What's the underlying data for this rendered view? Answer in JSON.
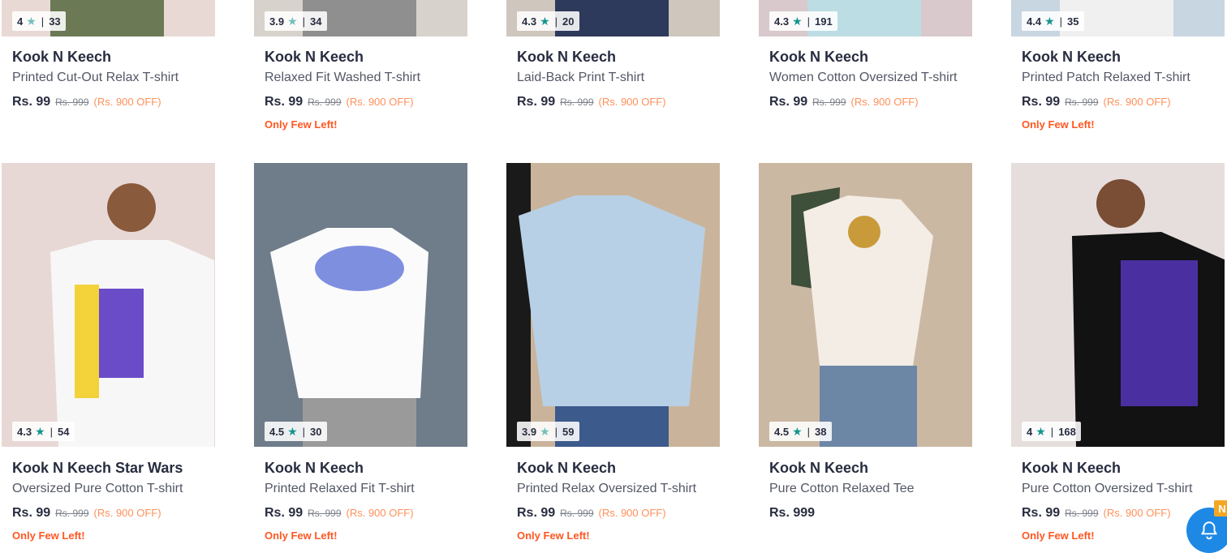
{
  "colors": {
    "star_teal": "#14958f",
    "star_light": "#72bfbc",
    "offer": "#ff905a",
    "few_left": "#ff5722",
    "bell": "#1e88e5"
  },
  "products": [
    {
      "rating": "4",
      "star": "light",
      "reviews": "33",
      "brand": "Kook N Keech",
      "name": "Printed Cut-Out Relax T-shirt",
      "price": "Rs. 99",
      "mrp": "Rs. 999",
      "off": "(Rs. 900 OFF)",
      "few": ""
    },
    {
      "rating": "3.9",
      "star": "light",
      "reviews": "34",
      "brand": "Kook N Keech",
      "name": "Relaxed Fit Washed T-shirt",
      "price": "Rs. 99",
      "mrp": "Rs. 999",
      "off": "(Rs. 900 OFF)",
      "few": "Only Few Left!"
    },
    {
      "rating": "4.3",
      "star": "teal",
      "reviews": "20",
      "brand": "Kook N Keech",
      "name": "Laid-Back Print T-shirt",
      "price": "Rs. 99",
      "mrp": "Rs. 999",
      "off": "(Rs. 900 OFF)",
      "few": ""
    },
    {
      "rating": "4.3",
      "star": "teal",
      "reviews": "191",
      "brand": "Kook N Keech",
      "name": "Women Cotton Oversized T-shirt",
      "price": "Rs. 99",
      "mrp": "Rs. 999",
      "off": "(Rs. 900 OFF)",
      "few": ""
    },
    {
      "rating": "4.4",
      "star": "teal",
      "reviews": "35",
      "brand": "Kook N Keech",
      "name": "Printed Patch Relaxed T-shirt",
      "price": "Rs. 99",
      "mrp": "Rs. 999",
      "off": "(Rs. 900 OFF)",
      "few": "Only Few Left!"
    },
    {
      "rating": "4.3",
      "star": "teal",
      "reviews": "54",
      "brand": "Kook N Keech Star Wars",
      "name": "Oversized Pure Cotton T-shirt",
      "price": "Rs. 99",
      "mrp": "Rs. 999",
      "off": "(Rs. 900 OFF)",
      "few": "Only Few Left!"
    },
    {
      "rating": "4.5",
      "star": "teal",
      "reviews": "30",
      "brand": "Kook N Keech",
      "name": "Printed Relaxed Fit T-shirt",
      "price": "Rs. 99",
      "mrp": "Rs. 999",
      "off": "(Rs. 900 OFF)",
      "few": "Only Few Left!"
    },
    {
      "rating": "3.9",
      "star": "light",
      "reviews": "59",
      "brand": "Kook N Keech",
      "name": "Printed Relax Oversized T-shirt",
      "price": "Rs. 99",
      "mrp": "Rs. 999",
      "off": "(Rs. 900 OFF)",
      "few": "Only Few Left!"
    },
    {
      "rating": "4.5",
      "star": "teal",
      "reviews": "38",
      "brand": "Kook N Keech",
      "name": "Pure Cotton Relaxed Tee",
      "price": "Rs. 999",
      "mrp": "",
      "off": "",
      "few": ""
    },
    {
      "rating": "4",
      "star": "teal",
      "reviews": "168",
      "brand": "Kook N Keech",
      "name": "Pure Cotton Oversized T-shirt",
      "price": "Rs. 99",
      "mrp": "Rs. 999",
      "off": "(Rs. 900 OFF)",
      "few": "Only Few Left!"
    }
  ],
  "photos": [
    {
      "bg": "#e9d9d4",
      "shirt": "#6b7a55"
    },
    {
      "bg": "#d8d2cc",
      "shirt": "#8f8f8f"
    },
    {
      "bg": "#cfc6bd",
      "shirt": "#2d3a5c"
    },
    {
      "bg": "#d9c9cc",
      "shirt": "#bcdde3"
    },
    {
      "bg": "#c8d6e2",
      "shirt": "#f0f0f0"
    },
    {
      "bg": "#e8d8d5",
      "shirt": "#f7f7f7"
    },
    {
      "bg": "#6f7c8a",
      "shirt": "#fbfbfb"
    },
    {
      "bg": "#c9b49b",
      "shirt": "#b8d0e6"
    },
    {
      "bg": "#cbb8a3",
      "shirt": "#f3ede6"
    },
    {
      "bg": "#e6dedd",
      "shirt": "#121212"
    }
  ],
  "notification": {
    "badge": "N"
  }
}
